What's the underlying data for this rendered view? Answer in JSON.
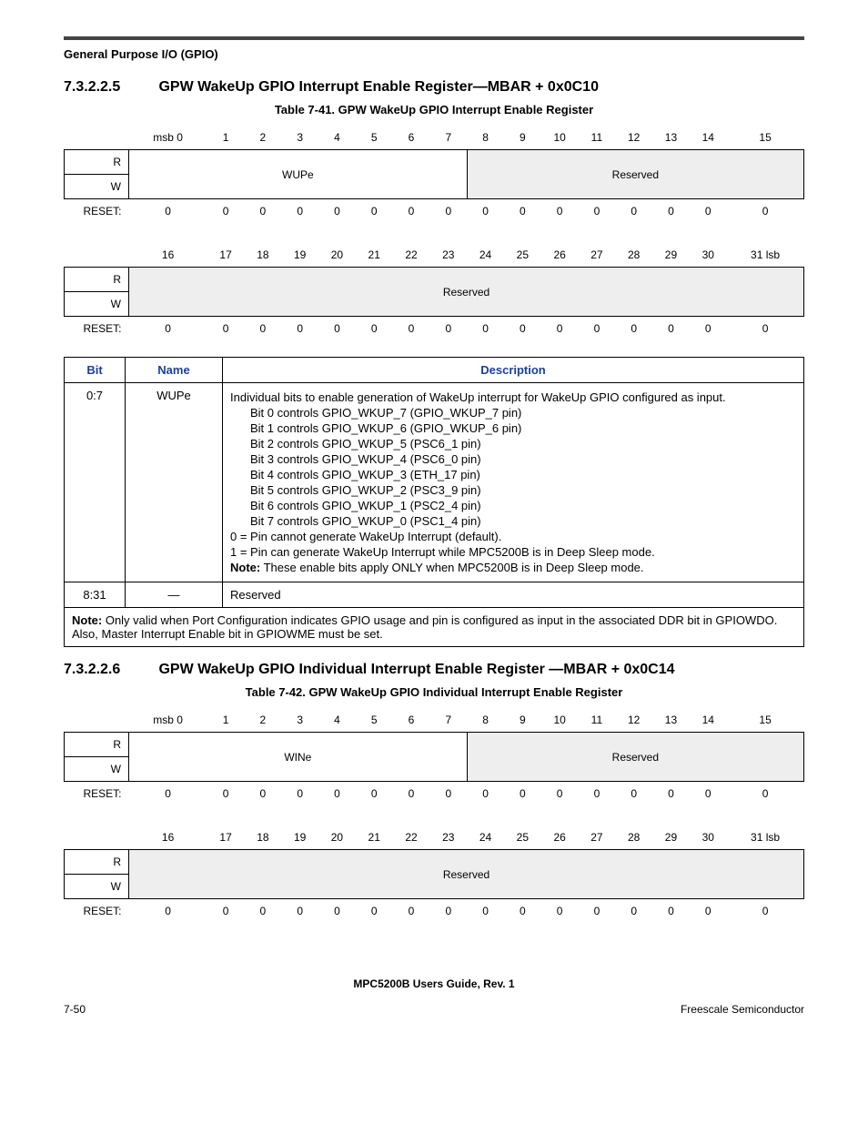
{
  "headerSection": "General Purpose I/O (GPIO)",
  "sec1": {
    "num": "7.3.2.2.5",
    "title": "GPW WakeUp GPIO Interrupt Enable Register—MBAR + 0x0C10",
    "caption": "Table 7-41. GPW WakeUp GPIO Interrupt Enable Register",
    "field1": "WUPe",
    "field2": "Reserved",
    "row2field": "Reserved",
    "field1name": "WINe"
  },
  "bits_top": [
    "msb 0",
    "1",
    "2",
    "3",
    "4",
    "5",
    "6",
    "7",
    "8",
    "9",
    "10",
    "11",
    "12",
    "13",
    "14",
    "15"
  ],
  "bits_bot": [
    "16",
    "17",
    "18",
    "19",
    "20",
    "21",
    "22",
    "23",
    "24",
    "25",
    "26",
    "27",
    "28",
    "29",
    "30",
    "31 lsb"
  ],
  "reset_zeros": [
    "0",
    "0",
    "0",
    "0",
    "0",
    "0",
    "0",
    "0",
    "0",
    "0",
    "0",
    "0",
    "0",
    "0",
    "0",
    "0"
  ],
  "rowlabels": {
    "R": "R",
    "W": "W",
    "RESET": "RESET:"
  },
  "descHeaders": {
    "bit": "Bit",
    "name": "Name",
    "desc": "Description"
  },
  "descRow1": {
    "bit": "0:7",
    "name": "WUPe",
    "intro": "Individual bits to enable generation of WakeUp interrupt for WakeUp GPIO configured as input.",
    "lines": [
      "Bit 0 controls GPIO_WKUP_7 (GPIO_WKUP_7 pin)",
      "Bit 1 controls GPIO_WKUP_6 (GPIO_WKUP_6 pin)",
      "Bit 2 controls GPIO_WKUP_5 (PSC6_1 pin)",
      "Bit 3 controls GPIO_WKUP_4 (PSC6_0 pin)",
      "Bit 4 controls GPIO_WKUP_3 (ETH_17 pin)",
      "Bit 5 controls GPIO_WKUP_2 (PSC3_9 pin)",
      "Bit 6 controls GPIO_WKUP_1 (PSC2_4 pin)",
      "Bit 7 controls GPIO_WKUP_0 (PSC1_4 pin)"
    ],
    "l0": "0 = Pin cannot generate WakeUp Interrupt (default).",
    "l1": "1 = Pin can generate WakeUp Interrupt while MPC5200B is in Deep Sleep mode.",
    "noteLabel": "Note:",
    "noteText": "  These enable bits apply ONLY when MPC5200B is in Deep Sleep mode."
  },
  "descRow2": {
    "bit": "8:31",
    "name": "—",
    "desc": "Reserved"
  },
  "footnote": {
    "label": "Note:",
    "text": "  Only valid when Port Configuration indicates GPIO usage and pin is configured as input in the associated DDR bit in GPIOWDO. Also, Master Interrupt Enable bit in GPIOWME must be set."
  },
  "sec2": {
    "num": "7.3.2.2.6",
    "title": "GPW WakeUp GPIO Individual Interrupt Enable Register —MBAR + 0x0C14",
    "caption": "Table 7-42. GPW WakeUp GPIO Individual Interrupt Enable Register",
    "field1": "WINe",
    "field2": "Reserved",
    "row2field": "Reserved"
  },
  "footer": {
    "center": "MPC5200B Users Guide, Rev. 1",
    "left": "7-50",
    "right": "Freescale Semiconductor"
  }
}
